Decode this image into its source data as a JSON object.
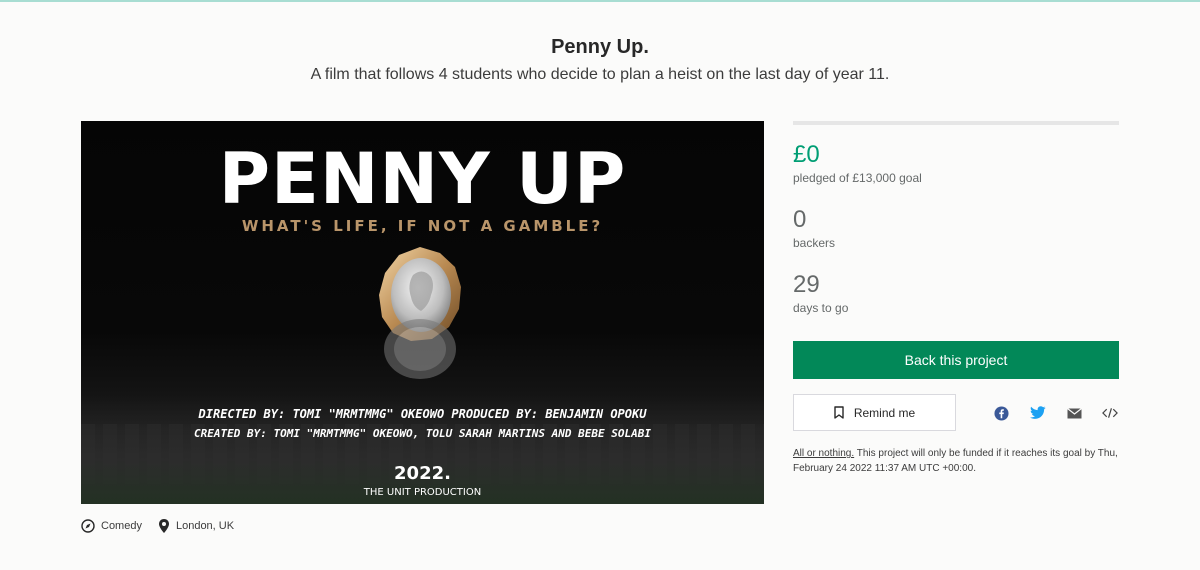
{
  "project": {
    "title": "Penny Up.",
    "blurb": "A film that follows 4 students who decide to plan a heist on the last day of year 11."
  },
  "poster": {
    "heading": "PENNY UP",
    "tagline": "WHAT'S LIFE, IF NOT A GAMBLE?",
    "credits_line1": "DIRECTED BY: TOMI \"MRMTMMG\" OKEOWO PRODUCED BY: BENJAMIN OPOKU",
    "credits_line2": "CREATED BY: TOMI \"MRMTMMG\" OKEOWO, TOLU SARAH MARTINS AND BEBE SOLABI",
    "year": "2022.",
    "company": "THE UNIT PRODUCTION"
  },
  "meta": {
    "category": "Comedy",
    "category_icon": "compass-icon",
    "location": "London, UK",
    "location_icon": "location-pin-icon"
  },
  "stats": {
    "progress_fraction": 0,
    "pledged": "£0",
    "pledged_label": "pledged of £13,000 goal",
    "backers": "0",
    "backers_label": "backers",
    "days": "29",
    "days_label": "days to go"
  },
  "actions": {
    "back_label": "Back this project",
    "remind_label": "Remind me",
    "remind_icon": "bookmark-icon",
    "share_icons": [
      "facebook-icon",
      "twitter-icon",
      "email-icon",
      "embed-icon"
    ]
  },
  "funding_note": {
    "link_text": "All or nothing.",
    "text": " This project will only be funded if it reaches its goal by Thu, February 24 2022 11:37 AM UTC +00:00."
  },
  "colors": {
    "pledged": "#009e74",
    "back_button": "#028858",
    "facebook": "#3b5998",
    "twitter": "#1da1f2",
    "tagline": "#b9956a"
  }
}
